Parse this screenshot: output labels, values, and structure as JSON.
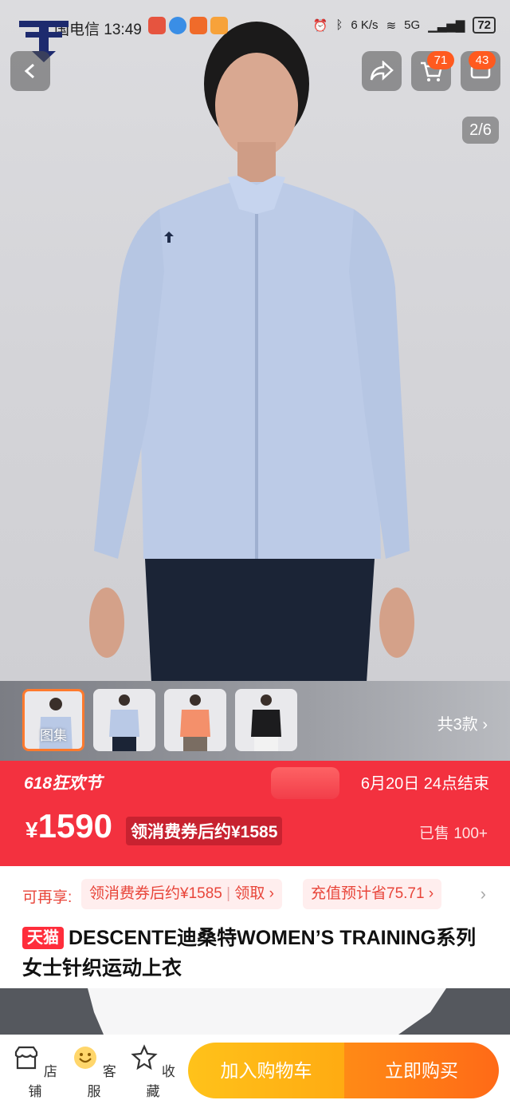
{
  "status_bar": {
    "carrier_time": "国电信 13:49",
    "net_speed": "6 K/s",
    "signal_labels": "5G",
    "battery": "72"
  },
  "hero": {
    "page_indicator": "2/6",
    "cart_badge": "71",
    "message_badge": "43"
  },
  "gallery": {
    "thumbs": [
      {
        "label": "图集",
        "color": "#b9c9e6"
      },
      {
        "label": "",
        "color": "#b9c9e6"
      },
      {
        "label": "",
        "color": "#f4906b"
      },
      {
        "label": "",
        "color": "#1c1c1e"
      }
    ],
    "variants_count": "共3款"
  },
  "price_bar": {
    "promo_name": "618狂欢节",
    "promo_end": "6月20日 24点结束",
    "currency": "¥",
    "price": "1590",
    "coupon_price": "领消费券后约¥1585",
    "sold": "已售 100+"
  },
  "benefits": {
    "label": "可再享:",
    "coupon_chip_text": "领消费券后约¥1585",
    "coupon_chip_action": "领取",
    "recharge_chip": "充值预计省75.71"
  },
  "title": {
    "tag": "天猫",
    "text": "DESCENTE迪桑特WOMEN’S TRAINING系列女士针织运动上衣"
  },
  "bottom_bar": {
    "store": "店铺",
    "service": "客服",
    "favorite": "收藏",
    "add_to_cart": "加入购物车",
    "buy_now": "立即购买"
  },
  "colors": {
    "accent_red": "#f3313f",
    "cart_yellow": "#ffb415",
    "buy_orange": "#ff7516",
    "jacket_blue": "#b9c9e6"
  }
}
